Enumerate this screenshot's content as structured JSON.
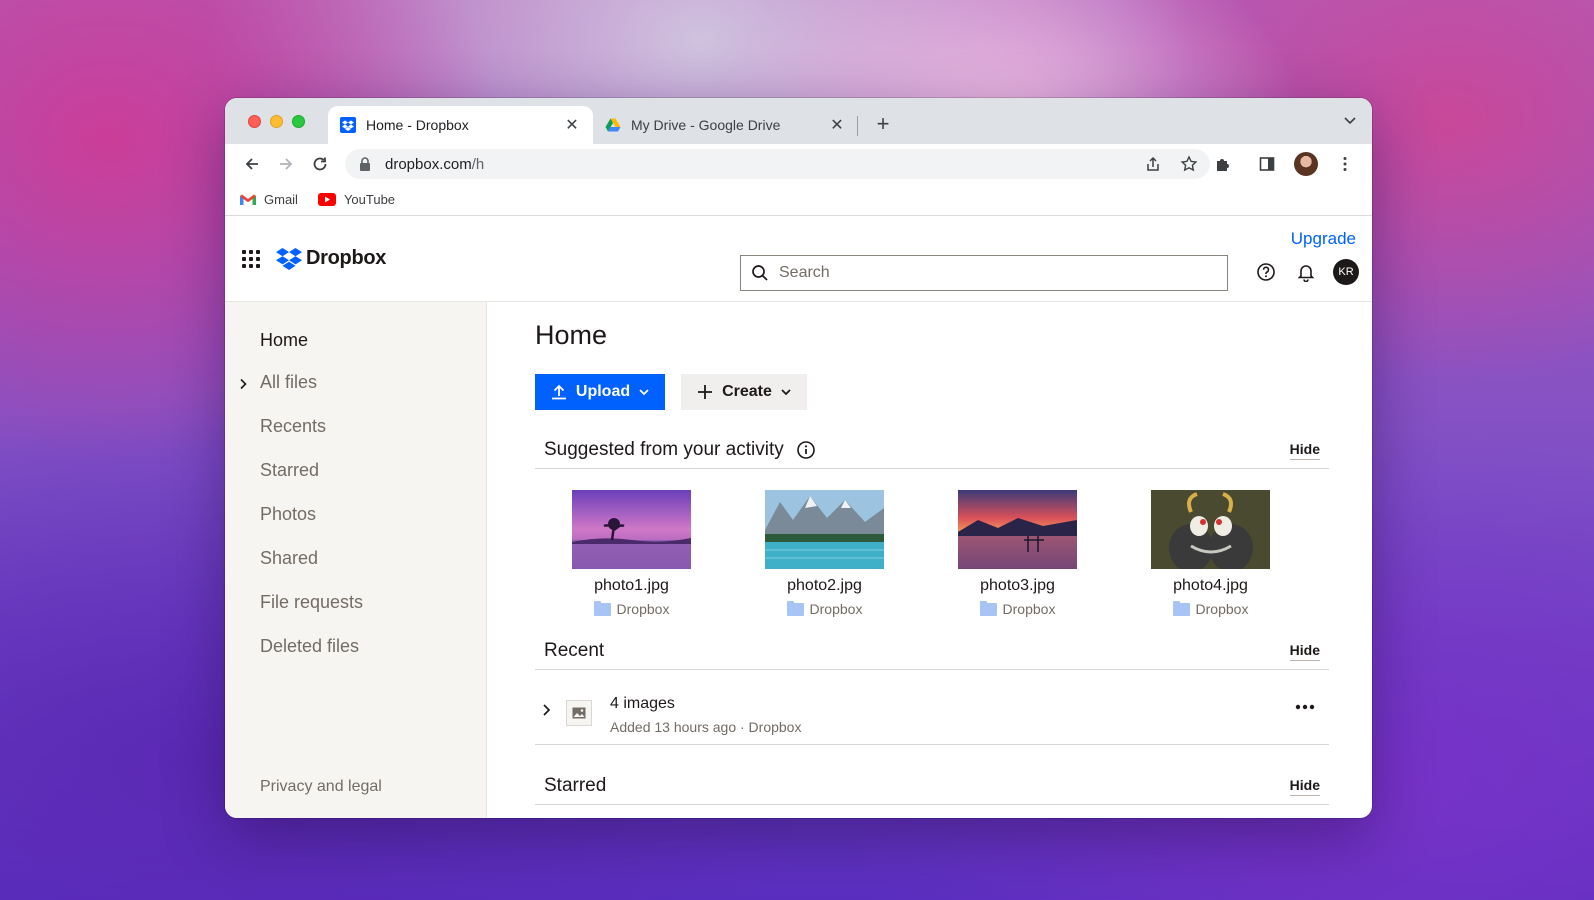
{
  "browser": {
    "tabs": [
      {
        "title": "Home - Dropbox",
        "close": "✕",
        "favicon": "dropbox-favicon"
      },
      {
        "title": "My Drive - Google Drive",
        "close": "✕",
        "favicon": "google-drive-favicon"
      }
    ],
    "new_tab": "+",
    "url_host": "dropbox.com",
    "url_path": "/h",
    "bookmarks": [
      {
        "label": "Gmail",
        "icon": "gmail-icon"
      },
      {
        "label": "YouTube",
        "icon": "youtube-icon"
      }
    ]
  },
  "header": {
    "logo_text": "Dropbox",
    "upgrade": "Upgrade",
    "search_placeholder": "Search",
    "avatar_initials": "KR"
  },
  "sidebar": {
    "items": [
      {
        "label": "Home",
        "active": true
      },
      {
        "label": "All files",
        "expandable": true
      },
      {
        "label": "Recents"
      },
      {
        "label": "Starred"
      },
      {
        "label": "Photos"
      },
      {
        "label": "Shared"
      },
      {
        "label": "File requests"
      },
      {
        "label": "Deleted files"
      }
    ],
    "footer": "Privacy and legal"
  },
  "main": {
    "title": "Home",
    "upload_label": "Upload",
    "create_label": "Create",
    "suggested": {
      "title": "Suggested from your activity",
      "hide": "Hide",
      "files": [
        {
          "name": "photo1.jpg",
          "location": "Dropbox"
        },
        {
          "name": "photo2.jpg",
          "location": "Dropbox"
        },
        {
          "name": "photo3.jpg",
          "location": "Dropbox"
        },
        {
          "name": "photo4.jpg",
          "location": "Dropbox"
        }
      ]
    },
    "recent": {
      "title": "Recent",
      "hide": "Hide",
      "row_title": "4 images",
      "row_subtitle": "Added 13 hours ago · Dropbox"
    },
    "starred": {
      "title": "Starred",
      "hide": "Hide"
    }
  },
  "colors": {
    "accent": "#0061fe",
    "text": "#1e1919",
    "muted": "#736c64"
  }
}
